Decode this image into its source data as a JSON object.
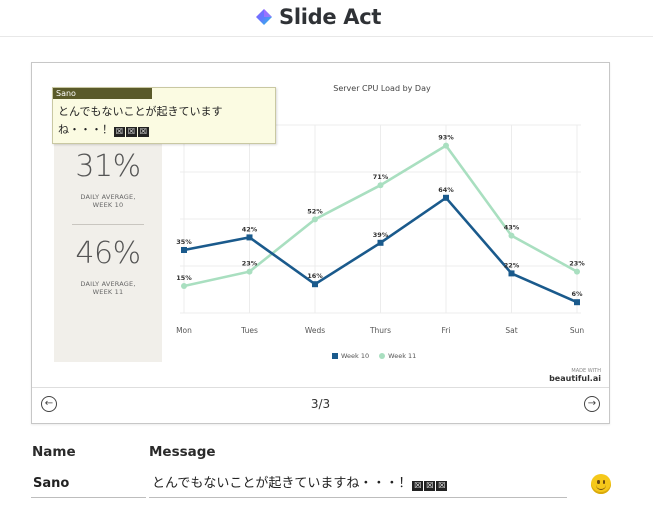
{
  "header": {
    "brand_name": "Slide Act",
    "logo_icon": "diamond-logo-icon",
    "colors": {
      "logo_gradient_start": "#7b61ff",
      "logo_gradient_end": "#24c6dc"
    }
  },
  "slide": {
    "stats": [
      {
        "value": "31%",
        "label_line1": "DAILY AVERAGE,",
        "label_line2": "WEEK 10"
      },
      {
        "value": "46%",
        "label_line1": "DAILY AVERAGE,",
        "label_line2": "WEEK 11"
      }
    ],
    "branding": {
      "made_with": "MADE WITH",
      "name": "beautiful.ai"
    }
  },
  "chart_data": {
    "type": "line",
    "title": "Server CPU Load by Day",
    "categories": [
      "Mon",
      "Tues",
      "Weds",
      "Thurs",
      "Fri",
      "Sat",
      "Sun"
    ],
    "ylim": [
      0,
      100
    ],
    "grid": true,
    "legend_position": "bottom",
    "series": [
      {
        "name": "Week 10",
        "color": "#1a5a8c",
        "values": [
          35,
          42,
          16,
          39,
          64,
          22,
          6
        ]
      },
      {
        "name": "Week 11",
        "color": "#a9dfc0",
        "values": [
          15,
          23,
          52,
          71,
          93,
          43,
          23
        ]
      }
    ]
  },
  "comment_popup": {
    "author": "Sano",
    "text": "とんでもないことが起きています",
    "text_line2": "ね・・・！",
    "box_glyph": "☒"
  },
  "navigation": {
    "prev_icon": "arrow-left-circle-icon",
    "next_icon": "arrow-right-circle-icon",
    "page_indicator": "3/3"
  },
  "form": {
    "name_header": "Name",
    "message_header": "Message",
    "name_value": "Sano",
    "message_value": "とんでもないことが起きていますね・・・！",
    "emoji_icon": "smiley-face-icon"
  }
}
